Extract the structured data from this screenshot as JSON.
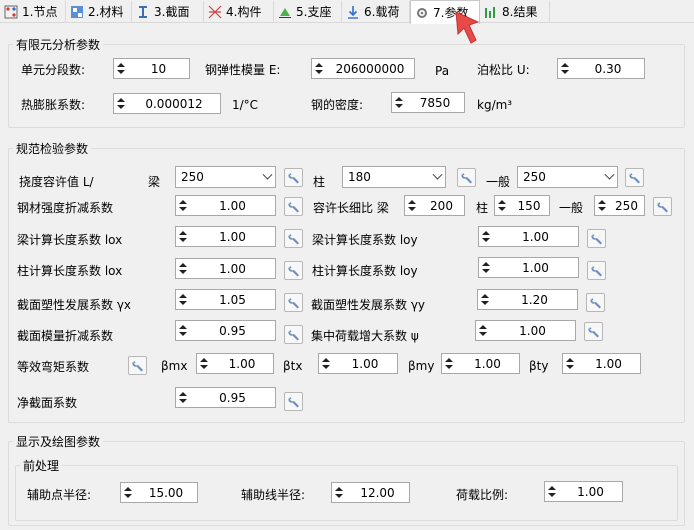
{
  "tabs": [
    {
      "label": "1.节点",
      "icon": "nodes-icon"
    },
    {
      "label": "2.材料",
      "icon": "material-icon"
    },
    {
      "label": "3.截面",
      "icon": "section-icon"
    },
    {
      "label": "4.构件",
      "icon": "member-icon"
    },
    {
      "label": "5.支座",
      "icon": "support-icon"
    },
    {
      "label": "6.载荷",
      "icon": "load-icon"
    },
    {
      "label": "7.参数",
      "icon": "parameter-icon",
      "active": true
    },
    {
      "label": "8.结果",
      "icon": "result-icon"
    }
  ],
  "fem": {
    "title": "有限元分析参数",
    "segments_label": "单元分段数:",
    "segments_value": "10",
    "modulus_label": "钢弹性模量 E:",
    "modulus_value": "206000000",
    "modulus_unit": "Pa",
    "poisson_label": "泊松比 U:",
    "poisson_value": "0.30",
    "thermal_label": "热膨胀系数:",
    "thermal_value": "0.000012",
    "thermal_unit": "1/°C",
    "density_label": "钢的密度:",
    "density_value": "7850",
    "density_unit": "kg/m³"
  },
  "code": {
    "title": "规范检验参数",
    "deflection_label": "挠度容许值 L/",
    "beam_label": "梁",
    "beam_value": "250",
    "column_label": "柱",
    "column_value": "180",
    "general_label": "一般",
    "general_value": "250",
    "strength_label": "钢材强度折减系数",
    "strength_value": "1.00",
    "slender_label": "容许长细比 梁",
    "slender_beam": "200",
    "slender_col_label": "柱",
    "slender_col": "150",
    "slender_gen_label": "一般",
    "slender_gen": "250",
    "beam_lox_label": "梁计算长度系数 lox",
    "beam_lox": "1.00",
    "beam_loy_label": "梁计算长度系数 loy",
    "beam_loy": "1.00",
    "col_lox_label": "柱计算长度系数 lox",
    "col_lox": "1.00",
    "col_loy_label": "柱计算长度系数 loy",
    "col_loy": "1.00",
    "plastic_x_label": "截面塑性发展系数 γx",
    "plastic_x": "1.05",
    "plastic_y_label": "截面塑性发展系数 γy",
    "plastic_y": "1.20",
    "modulus_red_label": "截面模量折减系数",
    "modulus_red": "0.95",
    "conc_label": "集中荷载增大系数 ψ",
    "conc": "1.00",
    "moment_label": "等效弯矩系数",
    "bmx_label": "βmx",
    "bmx": "1.00",
    "btx_label": "βtx",
    "btx": "1.00",
    "bmy_label": "βmy",
    "bmy": "1.00",
    "bty_label": "βty",
    "bty": "1.00",
    "net_label": "净截面系数",
    "net": "0.95"
  },
  "display": {
    "title": "显示及绘图参数",
    "pre_title": "前处理",
    "aux_point_label": "辅助点半径:",
    "aux_point": "15.00",
    "aux_line_label": "辅助线半径:",
    "aux_line": "12.00",
    "load_scale_label": "荷载比例:",
    "load_scale": "1.00"
  }
}
